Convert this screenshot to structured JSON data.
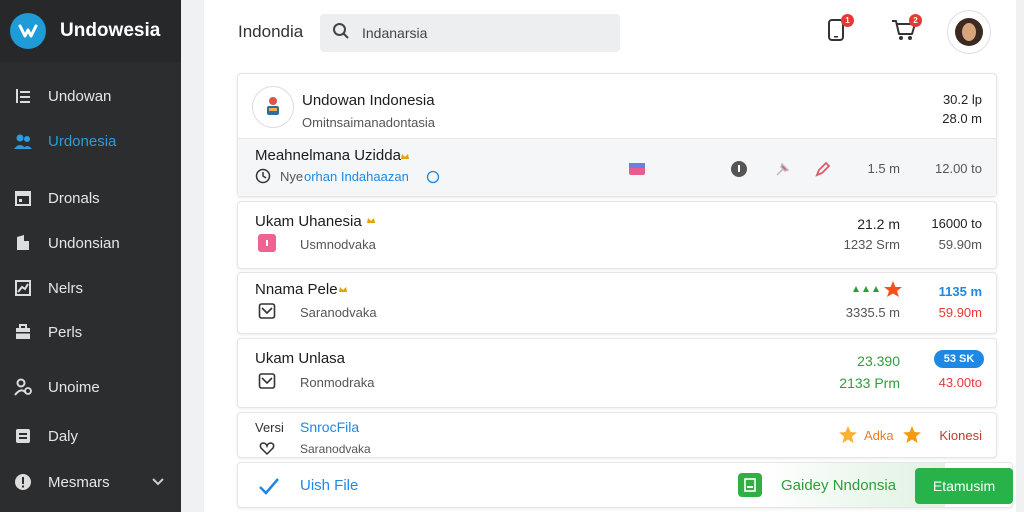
{
  "sidebar": {
    "brand": "Undowesia",
    "items": [
      {
        "label": "Undowan",
        "icon": "list-icon"
      },
      {
        "label": "Urdonesia",
        "icon": "users-icon",
        "active": true
      },
      {
        "label": "Dronals",
        "icon": "calendar-icon"
      },
      {
        "label": "Undonsian",
        "icon": "building-icon"
      },
      {
        "label": "Nelrs",
        "icon": "chart-icon"
      },
      {
        "label": "Perls",
        "icon": "briefcase-icon"
      },
      {
        "label": "Unoime",
        "icon": "user-gear-icon"
      },
      {
        "label": "Daly",
        "icon": "document-icon"
      },
      {
        "label": "Mesmars",
        "icon": "info-icon"
      }
    ]
  },
  "topbar": {
    "title": "Indondia",
    "search_value": "Indanarsia",
    "notif_count": "1",
    "cart_count": "2"
  },
  "cards": {
    "header": {
      "title": "Undowan Indonesia",
      "subtitle": "Omitnsaimanadontasia",
      "right_top": "30.2 lp",
      "right_bottom": "28.0 m"
    },
    "header_row2": {
      "title": "Meahnelmana Uzidda",
      "subtitle_prefix": "Nye",
      "subtitle_link": "orhan Indahaazan",
      "val1": "1.5 m",
      "val2": "12.00 to"
    },
    "row1": {
      "title": "Ukam Uhanesia",
      "subtitle": "Usmnodvaka",
      "val1_top": "21.2 m",
      "val1_bottom": "1232 Srm",
      "val2_top": "16000 to",
      "val2_bottom": "59.90m"
    },
    "row2": {
      "title": "Nnama Pele",
      "subtitle": "Saranodvaka",
      "val1_bottom": "3335.5 m",
      "val2_top": "1135 m",
      "val2_bottom": "59.90m"
    },
    "row3": {
      "title": "Ukam Unlasa",
      "subtitle": "Ronmodraka",
      "val1_top": "23.390",
      "val1_bottom": "2133 Prm",
      "pill": "53 SK",
      "val2_bottom": "43.00to"
    },
    "row4": {
      "title_prefix": "Versi",
      "title_link": "SnrocFila",
      "subtitle": "Saranodvaka",
      "tag": "Adka",
      "right": "Kionesi"
    }
  },
  "bottom": {
    "label": "Uish File",
    "green_label": "Gaidey Nndonsia",
    "button": "Etamusim"
  },
  "colors": {
    "sidebar_bg": "#2b2d2f",
    "accent_blue": "#2a9de0",
    "green": "#27b24a",
    "red": "#e53935"
  }
}
